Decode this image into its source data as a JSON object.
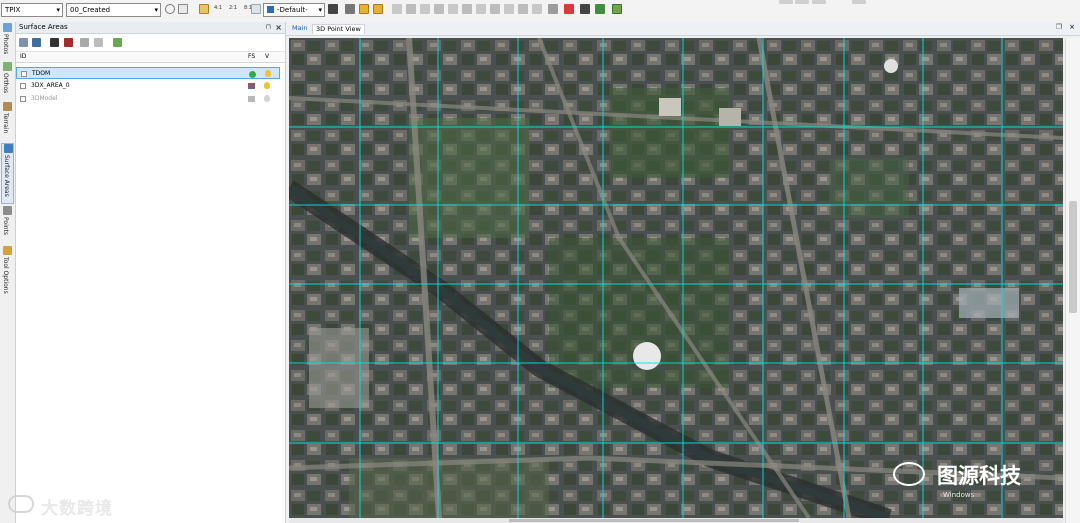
{
  "toolbar": {
    "combo1": "TPIX",
    "combo2": "00_Created",
    "combo3": "-Default-",
    "zoom_labels": [
      "4:1",
      "2:1",
      "8:1"
    ]
  },
  "side_tabs": [
    "Photos",
    "Orthos",
    "Terrain",
    "Surface Areas",
    "Points",
    "Tool Options"
  ],
  "panel": {
    "title": "Surface Areas",
    "col_id": "ID",
    "col_fs": "FS",
    "col_v": "V",
    "rows": [
      {
        "name": "TDOM"
      },
      {
        "name": "3DX_AREA_0"
      },
      {
        "name": "3DModel"
      }
    ]
  },
  "view": {
    "tab_main": "Main",
    "tab_pv": "3D Point View"
  },
  "watermarks": {
    "left": "大数跨境",
    "right": "图源科技",
    "right_sub": "Windows"
  },
  "colors": {
    "accent": "#1a63b8",
    "selection": "#cfe6fb",
    "grid": "#00e5e5"
  },
  "icons": [
    "pan-icon",
    "cursor-icon",
    "fit-icon",
    "layer-icon",
    "save-icon",
    "lock-icon",
    "pin-icon",
    "close-icon",
    "bulb-icon"
  ]
}
